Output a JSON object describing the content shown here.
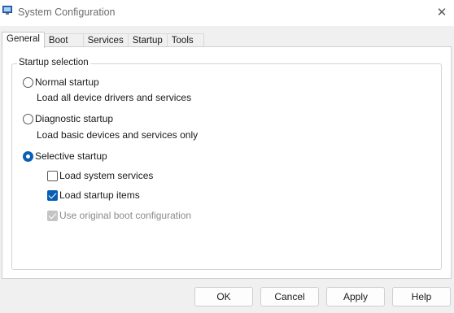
{
  "window": {
    "title": "System Configuration",
    "close_glyph": "✕"
  },
  "tabs": [
    "General",
    "Boot",
    "Services",
    "Startup",
    "Tools"
  ],
  "startup_selection": {
    "legend": "Startup selection",
    "normal": {
      "label": "Normal startup",
      "desc": "Load all device drivers and services",
      "selected": false
    },
    "diagnostic": {
      "label": "Diagnostic startup",
      "desc": "Load basic devices and services only",
      "selected": false
    },
    "selective": {
      "label": "Selective startup",
      "selected": true,
      "options": {
        "system_services": {
          "label": "Load system services",
          "checked": false
        },
        "startup_items": {
          "label": "Load startup items",
          "checked": true
        },
        "boot_config": {
          "label": "Use original boot configuration",
          "checked": true,
          "disabled": true
        }
      }
    }
  },
  "buttons": {
    "ok": "OK",
    "cancel": "Cancel",
    "apply": "Apply",
    "help": "Help"
  },
  "colors": {
    "accent": "#0a5fb4"
  }
}
